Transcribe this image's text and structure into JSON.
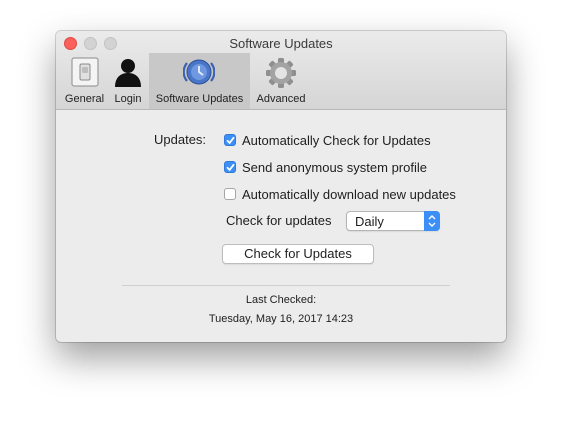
{
  "window": {
    "title": "Software Updates"
  },
  "toolbar": {
    "tabs": [
      {
        "label": "General",
        "icon": "switch-icon"
      },
      {
        "label": "Login",
        "icon": "user-silhouette-icon"
      },
      {
        "label": "Software Updates",
        "icon": "software-update-icon"
      },
      {
        "label": "Advanced",
        "icon": "gear-icon"
      }
    ],
    "selected_tab": "Software Updates"
  },
  "updates": {
    "section_label": "Updates:",
    "options": [
      {
        "label": "Automatically Check for Updates",
        "checked": true
      },
      {
        "label": "Send anonymous system profile",
        "checked": true
      },
      {
        "label": "Automatically download new updates",
        "checked": false
      }
    ],
    "frequency_label": "Check for updates",
    "frequency_value": "Daily",
    "check_button_label": "Check for Updates"
  },
  "status": {
    "last_checked_label": "Last Checked:",
    "last_checked_value": "Tuesday, May 16, 2017 14:23"
  },
  "colors": {
    "accent": "#3c8ff7",
    "close": "#fc605b"
  }
}
